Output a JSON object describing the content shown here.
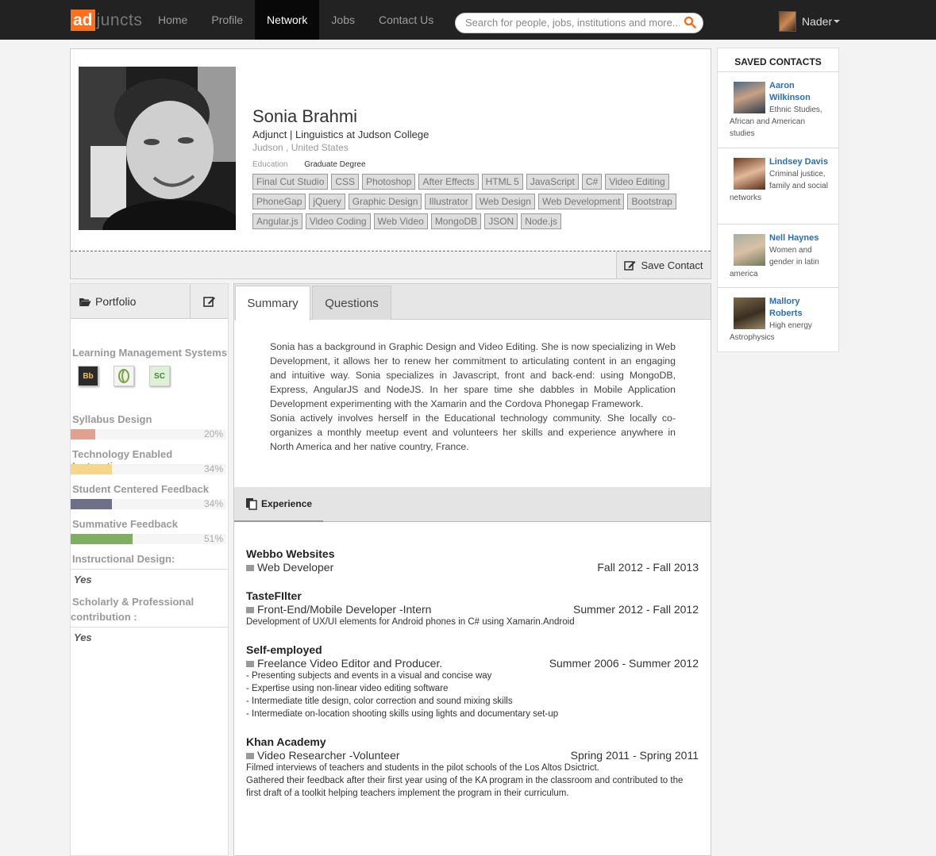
{
  "nav": {
    "logo_ad": "ad",
    "logo_rest": "juncts",
    "links": [
      "Home",
      "Profile",
      "Network",
      "Jobs",
      "Contact Us"
    ],
    "active": "Network",
    "search_placeholder": "Search for people, jobs, institutions and more...",
    "user_name": "Nader"
  },
  "profile": {
    "name": "Sonia Brahmi",
    "title": "Adjunct | Linguistics at Judson College",
    "location": "Judson , United States",
    "education_label": "Education",
    "education_value": "Graduate Degree",
    "skills": [
      "Final Cut Studio",
      "CSS",
      "Photoshop",
      "After Effects",
      "HTML 5",
      "JavaScript",
      "C#",
      "Video Editing",
      "PhoneGap",
      "jQuery",
      "Graphic Design",
      "Illustrator",
      "Web Design",
      "Web Development",
      "Bootstrap",
      "Angular.js",
      "Video Coding",
      "Web Video",
      "MongoDB",
      "JSON",
      "Node.js"
    ],
    "save_label": "Save Contact"
  },
  "saved": {
    "title": "SAVED CONTACTS",
    "contacts": [
      {
        "name": "Aaron Wilkinson",
        "desc": "Ethnic Studies, African and American studies"
      },
      {
        "name": "Lindsey Davis",
        "desc": "Criminal justice, family and social networks"
      },
      {
        "name": "Nell Haynes",
        "desc": "Women and gender in latin america"
      },
      {
        "name": "Mallory Roberts",
        "desc": "High energy Astrophysics"
      }
    ]
  },
  "portfolio": {
    "title": "Portfolio",
    "lms_label": "Learning Management Systems",
    "lms_icons": [
      "Bb",
      "",
      "SC"
    ],
    "skills": [
      {
        "label": "Syllabus Design",
        "pct": "20%",
        "value": 20,
        "color": "#e0a190"
      },
      {
        "label": "Technology Enabled Instruction",
        "pct": "34%",
        "value": 34,
        "color": "#f5d68a"
      },
      {
        "label": "Student Centered Feedback",
        "pct": "34%",
        "value": 34,
        "color": "#6f6f88"
      },
      {
        "label": "Summative Feedback",
        "pct": "51%",
        "value": 51,
        "color": "#7fae62"
      }
    ],
    "instructional_label": "Instructional Design:",
    "instructional_value": "Yes",
    "scholarly_label_1": "Scholarly & Professional",
    "scholarly_label_2": "contribution :",
    "scholarly_value": "Yes"
  },
  "tabs": {
    "summary": "Summary",
    "questions": "Questions"
  },
  "summary": {
    "p1": "Sonia has a background in Graphic Design and Video Editing. She is now specializing in Web Development, it allows her to renew her commitment to articulating content in an engaging and intuitive way. Sonia specializes in Javascript, front and back-end: using MongoDB, Express, AngularJS and NodeJS. In her spare time she dabbles in Mobile Application Development experimenting with the Xamarin and the Cordova Phonegap Framework.",
    "p2": "Sonia actively involves herself in the Educational technology community. She locally co-organizes a monthly meetup event and volunteers her skills and experience anywhere in North America and her native country, France."
  },
  "experience": {
    "title": "Experience",
    "jobs": [
      {
        "company": "Webbo Websites",
        "role": "Web Developer",
        "dates": "Fall 2012 - Fall 2013",
        "desc": []
      },
      {
        "company": "TasteFIlter",
        "role": "Front-End/Mobile Developer -Intern",
        "dates": "Summer 2012 - Fall 2012",
        "desc": [
          "Development of UX/UI elements for Android phones in C# using Xamarin.Android"
        ]
      },
      {
        "company": "Self-employed",
        "role": "Freelance Video Editor and Producer.",
        "dates": "Summer 2006 - Summer 2012",
        "desc": [
          "- Presenting subjects and events in a visual and concise way",
          "- Expertise using non-linear video editing software",
          "- Intermediate title design, color correction and sound mixing skills",
          "- Intermediate on-location shooting skills using lights and documentary set-up"
        ]
      },
      {
        "company": "Khan Academy",
        "role": "Video Researcher -Volunteer",
        "dates": "Spring 2011 - Spring 2011",
        "desc": [
          "Filmed interviews of teachers and students in the pilot schools of the Los Altos Dsictrict.",
          "Gathered their feedback after their first year using of the KA program in the classroom and contributed to the first draft of a toolkit helping teachers implement the program in their curriculum."
        ]
      }
    ]
  }
}
